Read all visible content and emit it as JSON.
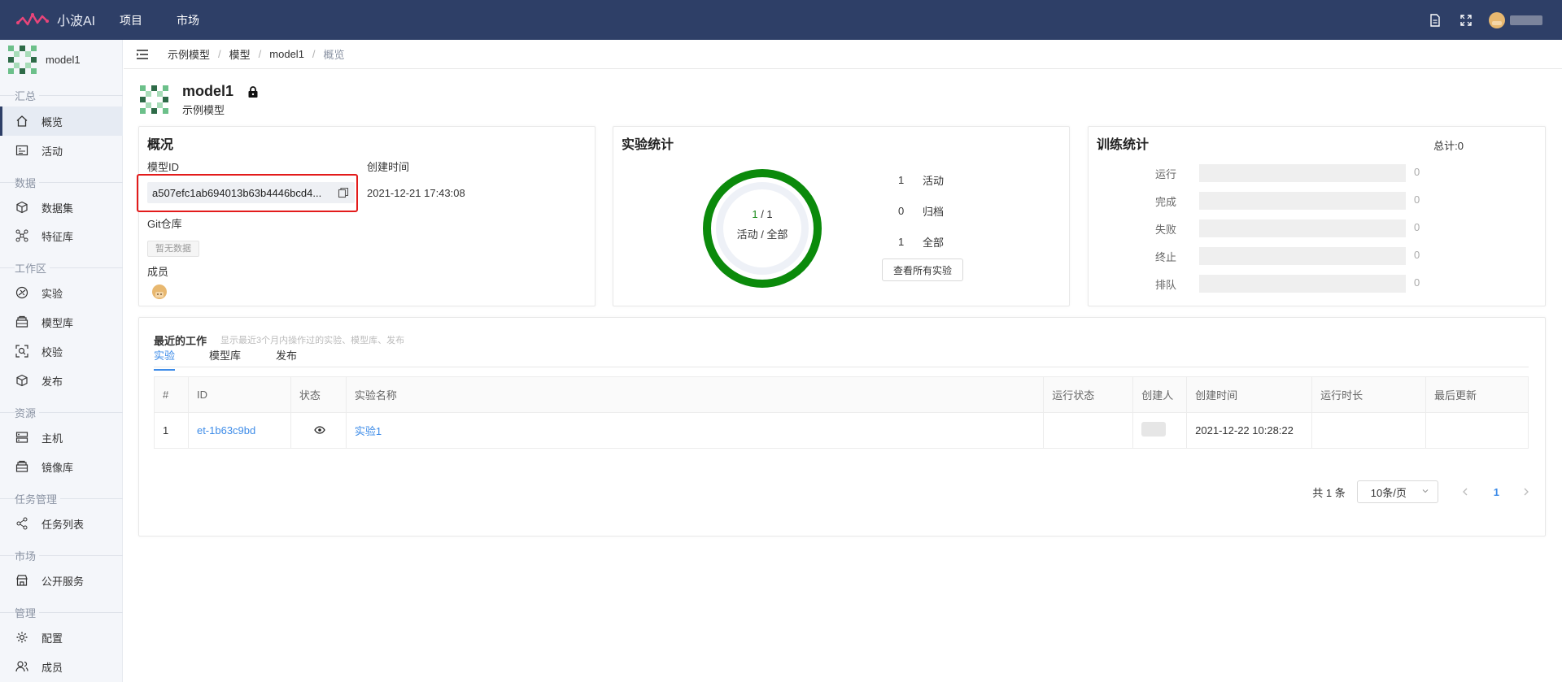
{
  "app": {
    "name": "小波AI"
  },
  "topnav": [
    "项目",
    "市场"
  ],
  "sidebar": {
    "model_name": "model1",
    "sections": {
      "summary": "汇总",
      "data": "数据",
      "workspace": "工作区",
      "resources": "资源",
      "tasks": "任务管理",
      "market": "市场",
      "admin": "管理"
    },
    "items": {
      "overview": "概览",
      "activity": "活动",
      "datasets": "数据集",
      "features": "特征库",
      "experiments": "实验",
      "models": "模型库",
      "validation": "校验",
      "publish": "发布",
      "hosts": "主机",
      "images": "镜像库",
      "task_list": "任务列表",
      "public_services": "公开服务",
      "config": "配置",
      "members": "成员"
    }
  },
  "breadcrumb": [
    "示例模型",
    "模型",
    "model1",
    "概览"
  ],
  "model": {
    "title": "model1",
    "subtitle": "示例模型"
  },
  "overview": {
    "title": "概况",
    "model_id_label": "模型ID",
    "model_id": "a507efc1ab694013b63b4446bcd4...",
    "created_label": "创建时间",
    "created_value": "2021-12-21 17:43:08",
    "git_label": "Git仓库",
    "no_data": "暂无数据",
    "members_label": "成员"
  },
  "experiment_stats": {
    "title": "实验统计",
    "active": "1",
    "total": "1",
    "ring_caption": "活动 / 全部",
    "ring_fraction": 1.0,
    "rows": [
      {
        "num": "1",
        "label": "活动"
      },
      {
        "num": "0",
        "label": "归档"
      },
      {
        "num": "1",
        "label": "全部"
      }
    ],
    "view_all": "查看所有实验",
    "ring_color": "#0b8a0b"
  },
  "training_stats": {
    "title": "训练统计",
    "total": "总计:0",
    "rows": [
      {
        "label": "运行",
        "value": "0"
      },
      {
        "label": "完成",
        "value": "0"
      },
      {
        "label": "失败",
        "value": "0"
      },
      {
        "label": "终止",
        "value": "0"
      },
      {
        "label": "排队",
        "value": "0"
      }
    ]
  },
  "recent": {
    "title": "最近的工作",
    "hint": "显示最近3个月内操作过的实验、模型库、发布",
    "tabs": [
      "实验",
      "模型库",
      "发布"
    ],
    "columns": [
      "#",
      "ID",
      "状态",
      "实验名称",
      "运行状态",
      "创建人",
      "创建时间",
      "运行时长",
      "最后更新"
    ],
    "rows": [
      {
        "idx": "1",
        "id": "et-1b63c9bd",
        "name": "实验1",
        "run_status": "",
        "created": "2021-12-22 10:28:22",
        "duration": "",
        "updated": ""
      }
    ],
    "pager": {
      "total": "共 1 条",
      "page_size": "10条/页",
      "page": "1"
    }
  },
  "colors": {
    "topbar": "#2e3f67",
    "accent": "#3e8ce8",
    "highlight": "#e31b1b"
  }
}
